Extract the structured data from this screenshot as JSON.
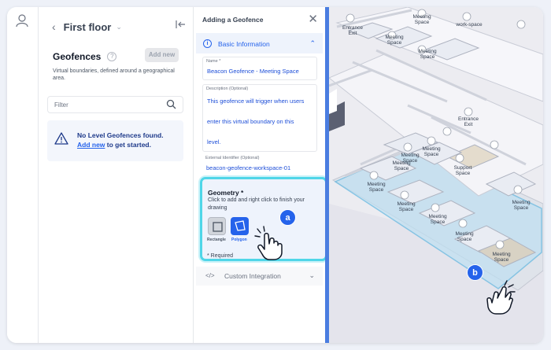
{
  "sidebar": {
    "user_icon": "user-icon"
  },
  "floor_panel": {
    "floor_name": "First floor",
    "section_title": "Geofences",
    "add_new_button": "Add new",
    "description": "Virtual boundaries, defined around a geographical area.",
    "filter_placeholder": "Filter",
    "empty_title": "No Level Geofences found.",
    "empty_link": "Add new",
    "empty_suffix": " to get started."
  },
  "form": {
    "title": "Adding a Geofence",
    "basic_info_label": "Basic Information",
    "name_label": "Name *",
    "name_value": "Beacon Geofence - Meeting Space",
    "desc_label": "Description (Optional)",
    "desc_lines": [
      "This geofence will trigger when users",
      "enter this virtual boundary on this",
      "level."
    ],
    "ext_label": "External Identifier (Optional)",
    "ext_value": "beacon-geofence-workspace-01",
    "geometry_title": "Geometry *",
    "geometry_desc": "Click to add and right click to finish your drawing",
    "rectangle_label": "Rectangle",
    "polygon_label": "Polygon",
    "required_note": "* Required",
    "custom_integration": "Custom Integration",
    "code_glyph": "</>"
  },
  "callouts": {
    "a": "a",
    "b": "b"
  },
  "map": {
    "labels": [
      {
        "text": "Entrance",
        "line2": "Exit"
      },
      {
        "text": "Meeting",
        "line2": "Space"
      },
      {
        "text": "Meeting",
        "line2": "Space"
      },
      {
        "text": "work-space",
        "line2": ""
      },
      {
        "text": "Meeting",
        "line2": "Space"
      },
      {
        "text": "Entrance",
        "line2": "Exit"
      },
      {
        "text": "Meeting",
        "line2": "Space"
      },
      {
        "text": "Meeting",
        "line2": "Space"
      },
      {
        "text": "Support",
        "line2": "Space"
      },
      {
        "text": "Meeting",
        "line2": "Space"
      },
      {
        "text": "Meeting",
        "line2": "Space"
      },
      {
        "text": "Meeting",
        "line2": "Space"
      },
      {
        "text": "Meeting",
        "line2": "Space"
      },
      {
        "text": "Meeting",
        "line2": "Space"
      },
      {
        "text": "Meeting",
        "line2": "Space"
      },
      {
        "text": "Meeting",
        "line2": "Space"
      }
    ]
  },
  "colors": {
    "accent": "#2563eb",
    "highlight": "#4fd6e8",
    "geofence_fill": "#bfe0f2"
  }
}
